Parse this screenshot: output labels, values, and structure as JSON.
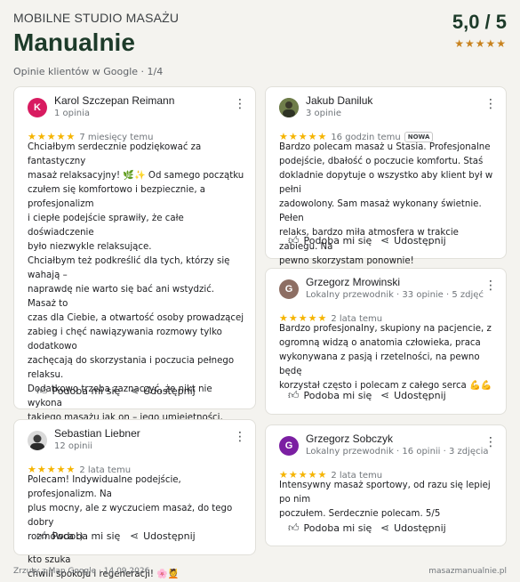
{
  "header": {
    "studio": "MOBILNE STUDIO MASAŻU",
    "brand": "Manualnie",
    "subtitle": "Opinie klientów w Google · 1/4",
    "score": "5,0 / 5",
    "score_stars": "★★★★★"
  },
  "actions": {
    "like": "Podoba mi się",
    "share": "Udostępnij"
  },
  "reviews": [
    {
      "name": "Karol Szczepan Reimann",
      "meta": "1 opinia",
      "initial": "K",
      "avatar_color": "#d81b60",
      "stars": "★★★★★",
      "ago": "7 miesięcy temu",
      "text": "Chciałbym serdecznie podziękować za fantastyczny\nmasaż relaksacyjny! 🌿✨ Od samego początku\nczułem się komfortowo i bezpiecznie, a profesjonalizm\ni ciepłe podejście sprawiły, że całe doświadczenie\nbyło niezwykle relaksujące.\nChciałbym też podkreślić dla tych, którzy się wahają –\nnaprawdę nie warto się bać ani wstydzić. Masaż to\nczas dla Ciebie, a otwartość osoby prowadzącej\nzabieg i chęć nawiązywania rozmowy tylko dodatkowo\nzachęcają do skorzystania i poczucia pełnego relaksu.\nDodatkowo trzeba zaznaczyć, że nikt nie wykona\ntakiego masażu jak on – jego umiejętności, męskie\ndłonie działają niesamowicie na ciało i naprawdę\npotrafią rozluźnić każdy mięsień.\nDziękuję raz jeszcze za wspaniały czas, profesjonalizm\ni atmosferę, w której naprawdę można odpocząć i się\nodprężyć. Zdecydowanie polecam każdemu, kto szuka\nchwili spokoju i regeneracji! 🌸💆"
    },
    {
      "name": "Jakub Daniluk",
      "meta": "3 opinie",
      "initial": "",
      "avatar_color": "#4a5a3a",
      "stars": "★★★★★",
      "ago": "16 godzin temu",
      "badge": "NOWA",
      "text": "Bardzo polecam masaż u Stasia. Profesjonalne\npodejście, dbałość o poczucie komfortu. Staś\ndokladnie dopytuje o wszystko aby klient był w pełni\nzadowolony. Sam masaż wykonany świetnie. Pełen\nrelaks, bardzo miła atmosfera w trakcie zabiegu. Na\npewno skorzystam ponownie!"
    },
    {
      "name": "Grzegorz Mrowinski",
      "meta": "Lokalny przewodnik · 33 opinie · 5 zdjęć",
      "initial": "G",
      "avatar_color": "#8d6e63",
      "stars": "★★★★★",
      "ago": "2 lata temu",
      "text": "Bardzo profesjonalny, skupiony na pacjencie, z\nogromną widzą o anatomia człowieka, praca\nwykonywana z pasją i rzetelności, na pewno będę\nkorzystał często i polecam z całego serca 💪💪"
    },
    {
      "name": "Sebastian Liebner",
      "meta": "12 opinii",
      "initial": "",
      "avatar_color": "#5a5a5a",
      "stars": "★★★★★",
      "ago": "2 lata temu",
      "text": "Polecam! Indywidualne podejście, profesjonalizm. Na\nplus mocny, ale z wyczuciem masaż, do tego dobry\nrozmówca :)"
    },
    {
      "name": "Grzegorz Sobczyk",
      "meta": "Lokalny przewodnik · 16 opinii · 3 zdjęcia",
      "initial": "G",
      "avatar_color": "#7b1fa2",
      "stars": "★★★★★",
      "ago": "2 lata temu",
      "text": "Intensywny masaż sportowy, od razu się lepiej po nim\npoczułem. Serdecznie polecam. 5/5"
    }
  ],
  "footer": {
    "left": "Zrzuty z Map Google · 14.09.2026",
    "right": "masazmanualnie.pl"
  }
}
